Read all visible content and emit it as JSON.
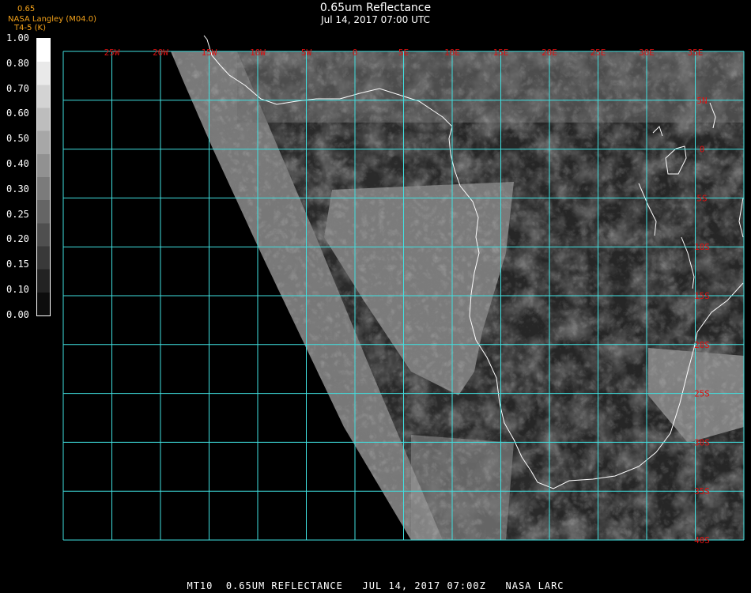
{
  "header": {
    "title": "0.65um Reflectance",
    "subtitle": "Jul 14, 2017 07:00 UTC",
    "credit_top": "0.65",
    "credit_main": "NASA Langley (M04.0)",
    "credit_sub": "T4-5 (K)"
  },
  "colorbar": {
    "labels": [
      "1.00",
      "0.80",
      "0.70",
      "0.60",
      "0.50",
      "0.40",
      "0.30",
      "0.25",
      "0.20",
      "0.15",
      "0.10",
      "0.00"
    ]
  },
  "map": {
    "lon_labels": [
      "25W",
      "20W",
      "15W",
      "10W",
      "5W",
      "0",
      "5E",
      "10E",
      "15E",
      "20E",
      "25E",
      "30E",
      "35E"
    ],
    "lat_labels": [
      "5N",
      "0",
      "5S",
      "10S",
      "15S",
      "20S",
      "25S",
      "30S",
      "35S",
      "40S"
    ],
    "grid_color": "#40e0e0",
    "tick_color": "#dd1111",
    "coast_color": "#ffffff"
  },
  "footer": {
    "text": "MT10  0.65UM REFLECTANCE   JUL 14, 2017 07:00Z   NASA LARC"
  }
}
